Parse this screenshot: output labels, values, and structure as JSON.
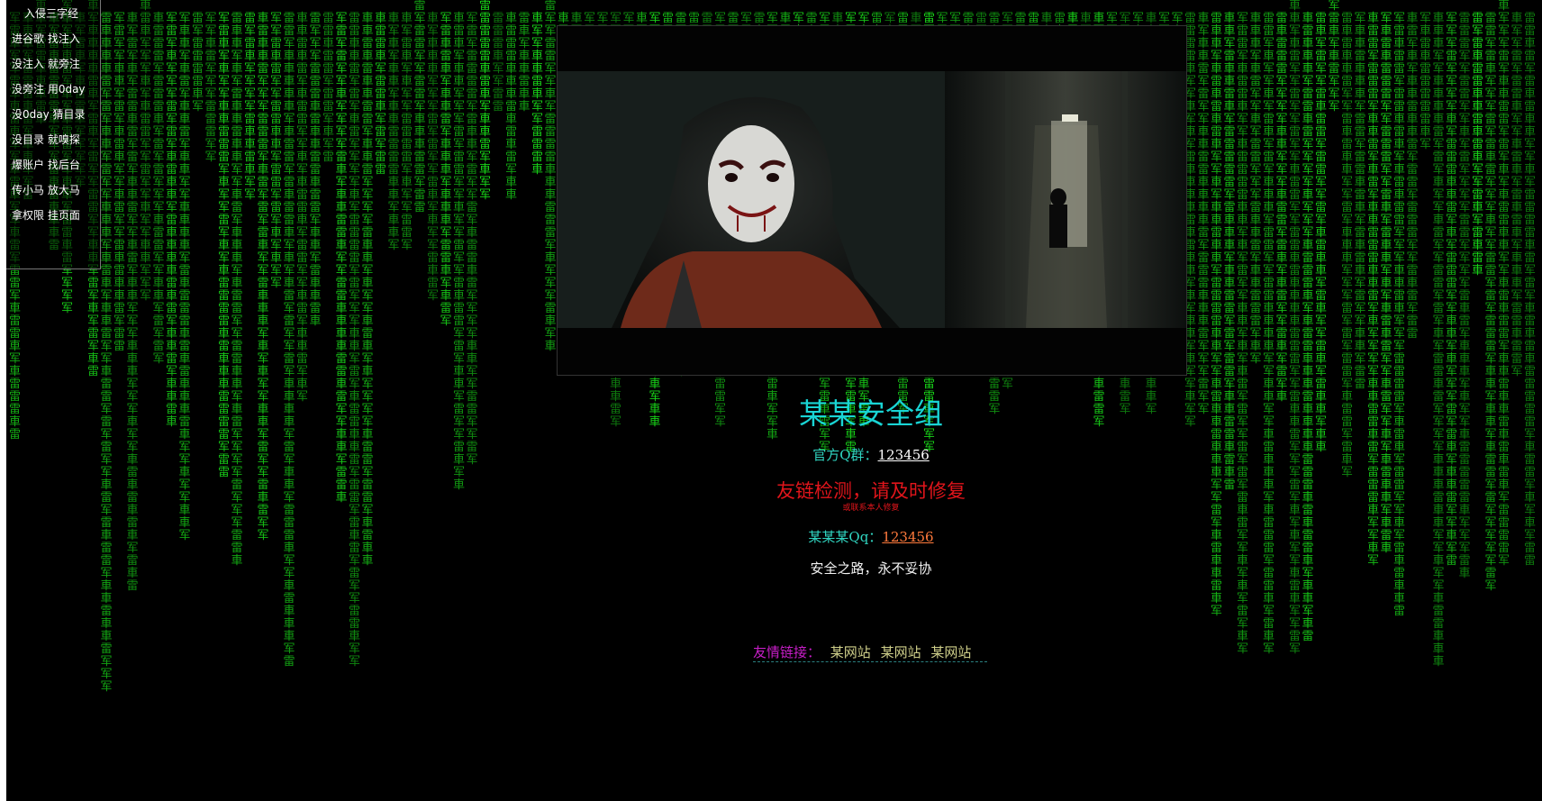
{
  "menu": {
    "title": "入侵三字经",
    "lines": [
      "进谷歌 找注入",
      "没注入 就旁注",
      "没旁注 用0day",
      "没0day 猜目录",
      "没目录 就嗅探",
      "爆账户 找后台",
      "传小马 放大马",
      "拿权限 挂页面"
    ]
  },
  "header": {
    "site_title": "某某安全组"
  },
  "contact": {
    "group_label": "官方Q群：",
    "group_value": "123456",
    "warning": "友链检测，请及时修复",
    "warning_sub": "或联系本人修复",
    "qq_label": "某某某Qq：",
    "qq_value": "123456",
    "motto": "安全之路，永不妥协"
  },
  "friends": {
    "label": "友情链接：",
    "links": [
      "某网站",
      "某网站",
      "某网站"
    ]
  },
  "colors": {
    "rain": "#19d619",
    "title": "#19d4d4",
    "warning": "#e0151b",
    "friends_label": "#c81ec8",
    "qq_value": "#ff7a3c"
  },
  "rain_glyphs": [
    "军",
    "雷",
    "車",
    "军",
    "車",
    "雷"
  ],
  "icons": {
    "video": "video-still-masked-figure"
  }
}
